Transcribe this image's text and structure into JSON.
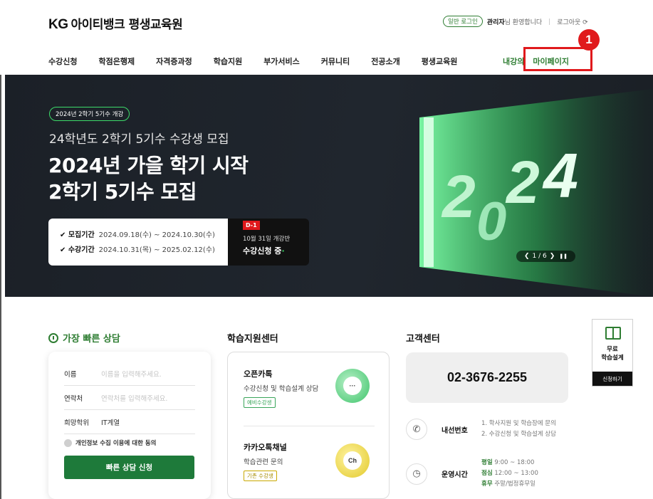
{
  "header": {
    "logo_kg": "KG",
    "logo_text": "아이티뱅크 평생교육원",
    "login_badge": "일반 로그인",
    "admin_name": "관리자",
    "greeting": "님 환영합니다",
    "logout": "로그아웃 ⟳"
  },
  "nav": {
    "items": [
      "수강신청",
      "학점은행제",
      "자격증과정",
      "학습지원",
      "부가서비스",
      "커뮤니티",
      "전공소개",
      "평생교육원"
    ],
    "my_lecture": "내강의",
    "my_page": "마이페이지"
  },
  "annotation": {
    "marker": "1"
  },
  "banner": {
    "badge": "2024년 2학기 5기수 개강",
    "subtitle": "24학년도 2학기 5기수 수강생 모집",
    "title_line1": "2024년 가을 학기 시작",
    "title_line2": "2학기 5기수 모집",
    "recruit_label": "✔ 모집기간",
    "recruit_value": "2024.09.18(수) ~ 2024.10.30(수)",
    "course_label": "✔ 수강기간",
    "course_value": "2024.10.31(목) ~ 2025.02.12(수)",
    "dday_tag": "D-1",
    "dday_line1": "10월 31일 개강반",
    "dday_line2": "수강신청 중",
    "slider_text": "1 / 6",
    "year_graphic": "2024"
  },
  "consult": {
    "title": "가장 빠른 상담",
    "name_label": "이름",
    "name_placeholder": "이름을 입력해주세요.",
    "phone_label": "연락처",
    "phone_placeholder": "연락처를 입력해주세요.",
    "major_label": "희망학위",
    "major_value": "IT계열",
    "agree_text": "개인정보 수집 이용에 대한 동의",
    "submit": "빠른 상담 신청"
  },
  "study_center": {
    "title": "학습지원센터",
    "item1_title": "오픈카톡",
    "item1_desc": "수강신청 및 학습설계 상담",
    "item1_tag": "예비수강생",
    "item2_title": "카카오톡채널",
    "item2_desc": "학습관련 문의",
    "item2_tag": "기존 수강생",
    "item2_icon_text": "Ch",
    "item1_icon_text": "···"
  },
  "customer_center": {
    "title": "고객센터",
    "phone": "02-3676-2255",
    "ext_label": "내선번호",
    "ext_line1": "1. 학사지원 및 학습장에 문의",
    "ext_line2": "2. 수강신청 및 학습설계 상담",
    "hours_label": "운영시간",
    "weekday_label": "평일",
    "weekday_value": "9:00 ~ 18:00",
    "lunch_label": "점심",
    "lunch_value": "12:00 ~ 13:00",
    "holiday_label": "휴무",
    "holiday_value": "주말/법정휴무일"
  },
  "side_widget": {
    "label_line1": "무료",
    "label_line2": "학습설계",
    "button": "신청하기"
  }
}
